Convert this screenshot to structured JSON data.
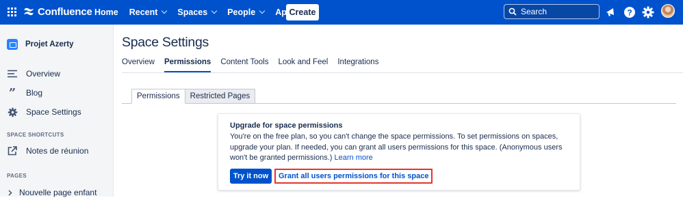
{
  "topbar": {
    "app_name": "Confluence",
    "nav": [
      "Home",
      "Recent",
      "Spaces",
      "People",
      "Apps"
    ],
    "create_label": "Create",
    "search_placeholder": "Search",
    "brand_color": "#0052cc"
  },
  "sidebar": {
    "space_name": "Projet Azerty",
    "items": [
      {
        "label": "Overview",
        "icon": "overview-icon"
      },
      {
        "label": "Blog",
        "icon": "quote-icon"
      },
      {
        "label": "Space Settings",
        "icon": "gear-icon"
      }
    ],
    "shortcuts_heading": "SPACE SHORTCUTS",
    "shortcuts": [
      {
        "label": "Notes de réunion",
        "icon": "external-link-icon"
      }
    ],
    "pages_heading": "PAGES",
    "pages": [
      {
        "label": "Nouvelle page enfant"
      }
    ]
  },
  "main": {
    "title": "Space Settings",
    "tabs": [
      {
        "label": "Overview",
        "active": false
      },
      {
        "label": "Permissions",
        "active": true
      },
      {
        "label": "Content Tools",
        "active": false
      },
      {
        "label": "Look and Feel",
        "active": false
      },
      {
        "label": "Integrations",
        "active": false
      }
    ],
    "subtabs": [
      {
        "label": "Permissions",
        "active": true
      },
      {
        "label": "Restricted Pages",
        "active": false
      }
    ],
    "card": {
      "title": "Upgrade for space permissions",
      "body": "You're on the free plan, so you can't change the space permissions. To set permissions on spaces, upgrade your plan. If needed, you can grant all users permissions for this space. (Anonymous users won't be granted permissions.)",
      "learn_more": "Learn more",
      "try_label": "Try it now",
      "grant_label": "Grant all users permissions for this space"
    }
  }
}
